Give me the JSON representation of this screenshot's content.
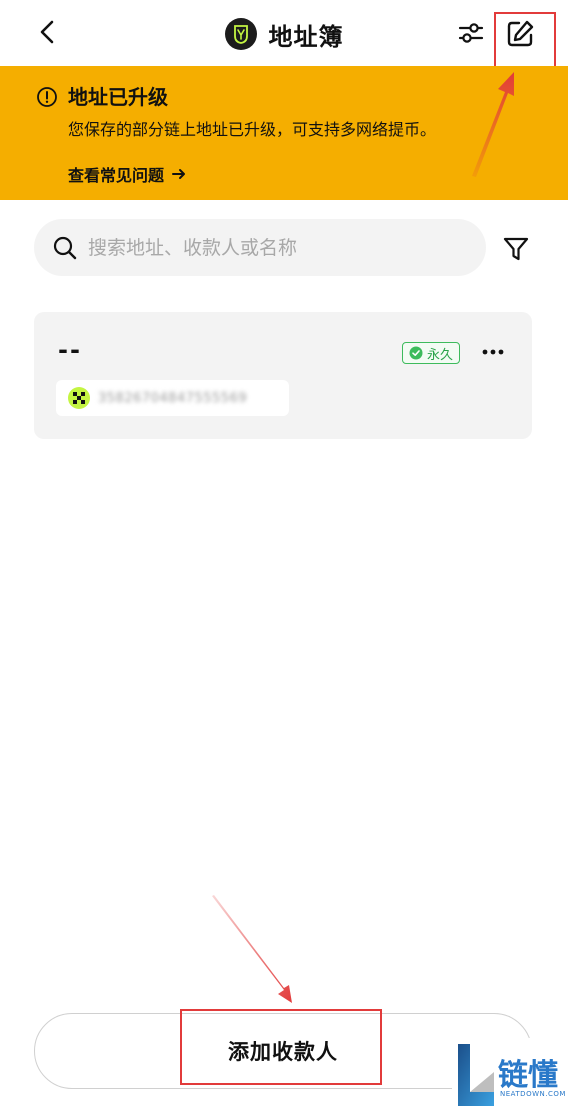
{
  "header": {
    "title": "地址簿"
  },
  "banner": {
    "title": "地址已升级",
    "description": "您保存的部分链上地址已升级，可支持多网络提币。",
    "link_label": "查看常见问题"
  },
  "search": {
    "placeholder": "搜索地址、收款人或名称",
    "value": ""
  },
  "address_list": [
    {
      "name": "--",
      "badge": "永久",
      "address": "35826704847555569"
    }
  ],
  "footer": {
    "add_label": "添加收款人"
  },
  "watermark": {
    "brand": "链懂",
    "sub": "NEATDOWN.COM"
  },
  "colors": {
    "banner": "#f5ae00",
    "highlight": "#e23b3b",
    "badge_green": "#3dbb5c",
    "chain_icon": "#c4f542"
  }
}
